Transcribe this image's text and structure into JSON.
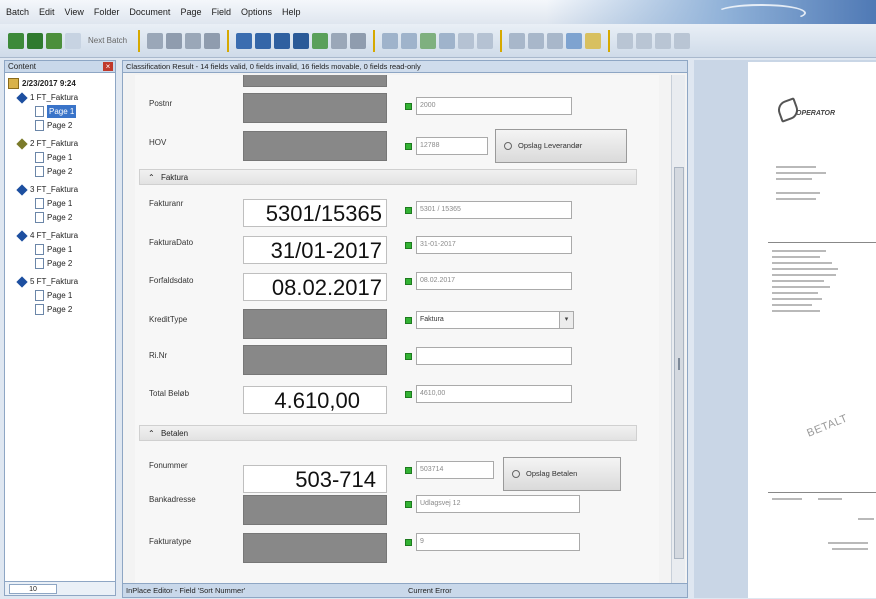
{
  "menu": [
    "Batch",
    "Edit",
    "View",
    "Folder",
    "Document",
    "Page",
    "Field",
    "Options",
    "Help"
  ],
  "toolbar": {
    "next_batch_label": "Next Batch"
  },
  "tree": {
    "header": "Content",
    "close_label": "×",
    "batch_label": "2/23/2017 9:24",
    "documents": [
      {
        "label": "1 FT_Faktura",
        "pages": [
          "Page 1",
          "Page 2"
        ]
      },
      {
        "label": "2 FT_Faktura",
        "pages": [
          "Page 1",
          "Page 2"
        ]
      },
      {
        "label": "3 FT_Faktura",
        "pages": [
          "Page 1",
          "Page 2"
        ]
      },
      {
        "label": "4 FT_Faktura",
        "pages": [
          "Page 1",
          "Page 2"
        ]
      },
      {
        "label": "5 FT_Faktura",
        "pages": [
          "Page 1",
          "Page 2"
        ]
      }
    ],
    "selected": "Page 1",
    "footer_value": "10"
  },
  "classification_header": "Classification Result - 14 fields valid, 0 fields invalid, 16 fields movable, 0 fields read-only",
  "form": {
    "sections": [
      {
        "label": "Faktura",
        "symbol": "⌃"
      },
      {
        "label": "Betalen",
        "symbol": "⌃"
      }
    ],
    "fields": {
      "postnr": {
        "label": "Postnr",
        "value": "2000"
      },
      "hov": {
        "label": "HOV",
        "value": "12788"
      },
      "fakturanr": {
        "label": "Fakturanr",
        "snippet": "5301/15365",
        "value": "5301 / 15365"
      },
      "fakturadato": {
        "label": "FakturaDato",
        "snippet": "31/01-2017",
        "value": "31-01-2017"
      },
      "forfaldsdato": {
        "label": "Forfaldsdato",
        "snippet": "08.02.2017",
        "value": "08.02.2017"
      },
      "kreditype": {
        "label": "KreditType",
        "value": "Faktura"
      },
      "ref": {
        "label": "Ri.Nr",
        "value": ""
      },
      "total": {
        "label": "Total Beløb",
        "snippet": "4.610,00",
        "value": "4610,00"
      },
      "fonummer": {
        "label": "Fonummer",
        "snippet": "503-714",
        "value": "503714"
      },
      "bankadresse": {
        "label": "Bankadresse",
        "value": "Udlagsvej 12"
      },
      "fakturatype": {
        "label": "Fakturatype",
        "value": "9"
      }
    },
    "lookup_vendor_label": "Opslag Leverandør",
    "lookup_betalen_label": "Opslag Betalen"
  },
  "status_bar": {
    "left": "InPlace Editor - Field 'Sort Nummer'",
    "right": "Current Error"
  },
  "preview": {
    "logo_word": "OPERATOR",
    "stamp": "BETALT"
  }
}
